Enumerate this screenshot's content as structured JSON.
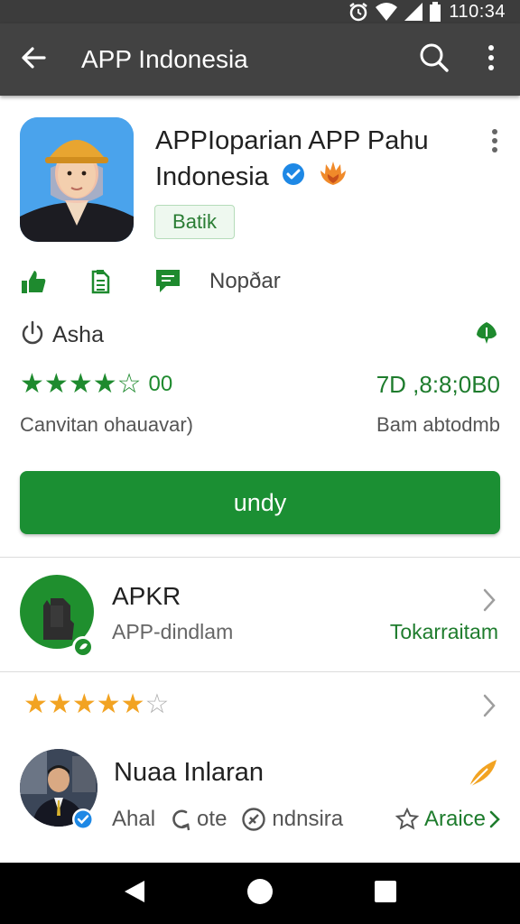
{
  "status_bar": {
    "time": "110:34",
    "icons": [
      "alarm-icon",
      "wifi-icon",
      "signal-icon",
      "battery-icon"
    ]
  },
  "app_bar": {
    "title": "APP Indonesia",
    "icons": [
      "back-arrow-icon",
      "search-icon",
      "more-vert-icon"
    ]
  },
  "app": {
    "name": "APPIoparian APP Pahu Indonesia",
    "category": "Batik",
    "meta_label": "Nopðar",
    "developer": "Asha",
    "stars_filled": 4,
    "stars_total": 5,
    "rating_count": "00",
    "downloads": "7D ,8:8;0B0",
    "subtitle_left": "Canvitan ohauavar)",
    "subtitle_right": "Bam abtodmb",
    "install_label": "undy"
  },
  "related": {
    "title": "APKR",
    "subtitle": "APP-dindlam",
    "link": "Tokarraitam"
  },
  "review": {
    "stars_filled": 5,
    "stars_total": 6,
    "reviewer": "Nuaa Inlaran",
    "action_1": "Ahal",
    "action_2": "ote",
    "action_3": "ndnsira",
    "link": "Araice"
  },
  "colors": {
    "app_bar": "#424242",
    "accent_green": "#1b8f33",
    "star_green": "#1e8a2e",
    "star_orange": "#f2a322",
    "verified_blue": "#1e88e5"
  }
}
